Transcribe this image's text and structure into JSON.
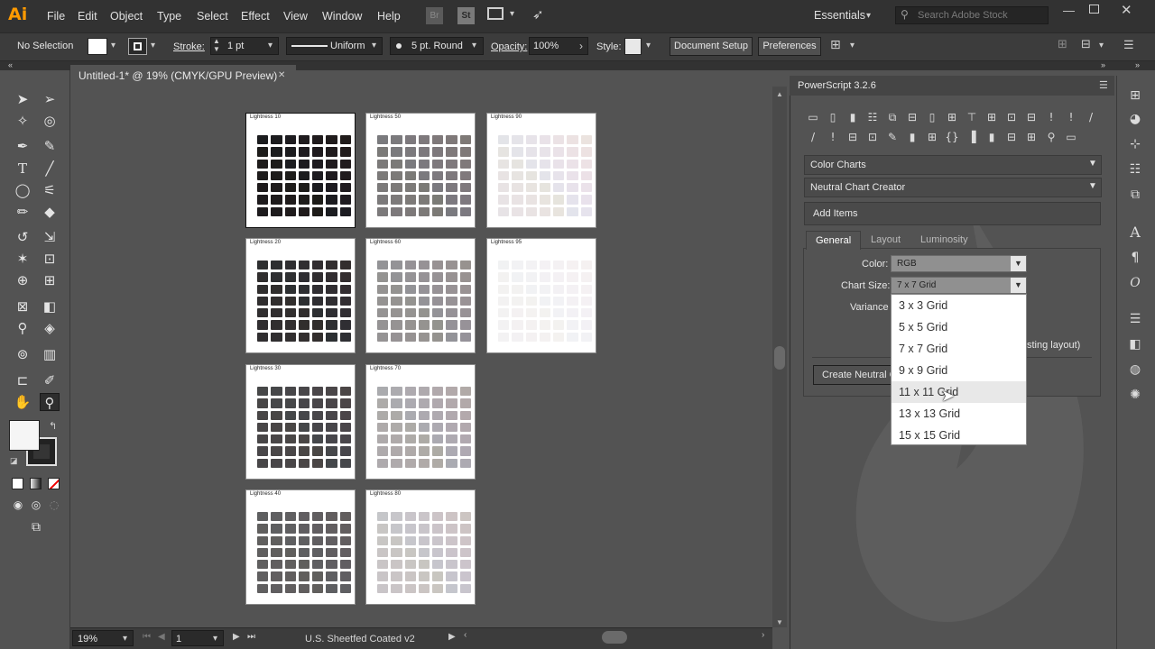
{
  "app": {
    "logo": "Ai"
  },
  "menus": [
    "File",
    "Edit",
    "Object",
    "Type",
    "Select",
    "Effect",
    "View",
    "Window",
    "Help"
  ],
  "bridge": {
    "br": "Br",
    "st": "St"
  },
  "workspace": "Essentials",
  "search": {
    "placeholder": "Search Adobe Stock"
  },
  "control": {
    "selection": "No Selection",
    "stroke_label": "Stroke:",
    "stroke_value": "1 pt",
    "stroke_style": "Uniform",
    "brush": "5 pt. Round",
    "opacity_label": "Opacity:",
    "opacity_value": "100%",
    "style_label": "Style:",
    "doc_setup": "Document Setup",
    "preferences": "Preferences"
  },
  "document": {
    "tab_title": "Untitled-1* @ 19% (CMYK/GPU Preview)"
  },
  "artboards": [
    {
      "title": "Lightness 10",
      "color": "#1b1c1f"
    },
    {
      "title": "Lightness 50",
      "color": "#7a7a7e"
    },
    {
      "title": "Lightness 90",
      "color": "#e3e4ea"
    },
    {
      "title": "Lightness 20",
      "color": "#2d2f31"
    },
    {
      "title": "Lightness 60",
      "color": "#939397"
    },
    {
      "title": "Lightness 95",
      "color": "#f1f2f4"
    },
    {
      "title": "Lightness 30",
      "color": "#454749"
    },
    {
      "title": "Lightness 70",
      "color": "#aaabb0"
    },
    {
      "title": "Lightness 40",
      "color": "#5e5f61"
    },
    {
      "title": "Lightness 80",
      "color": "#c5c6cb"
    }
  ],
  "status": {
    "zoom": "19%",
    "page": "1",
    "profile": "U.S. Sheetfed Coated v2"
  },
  "panel": {
    "title": "PowerScript 3.2.6",
    "category": "Color Charts",
    "script": "Neutral Chart Creator",
    "add_items": "Add Items",
    "tabs": [
      "General",
      "Layout",
      "Luminosity"
    ],
    "color_label": "Color:",
    "color_value": "RGB",
    "size_label": "Chart Size:",
    "size_value": "7 x 7 Grid",
    "variance_label": "Variance",
    "layout_note": "sting layout)",
    "create_button": "Create Neutral C",
    "size_options": [
      "3 x 3 Grid",
      "5 x 5 Grid",
      "7 x 7 Grid",
      "9 x 9 Grid",
      "11 x 11 Grid",
      "13 x 13 Grid",
      "15 x 15 Grid"
    ]
  }
}
